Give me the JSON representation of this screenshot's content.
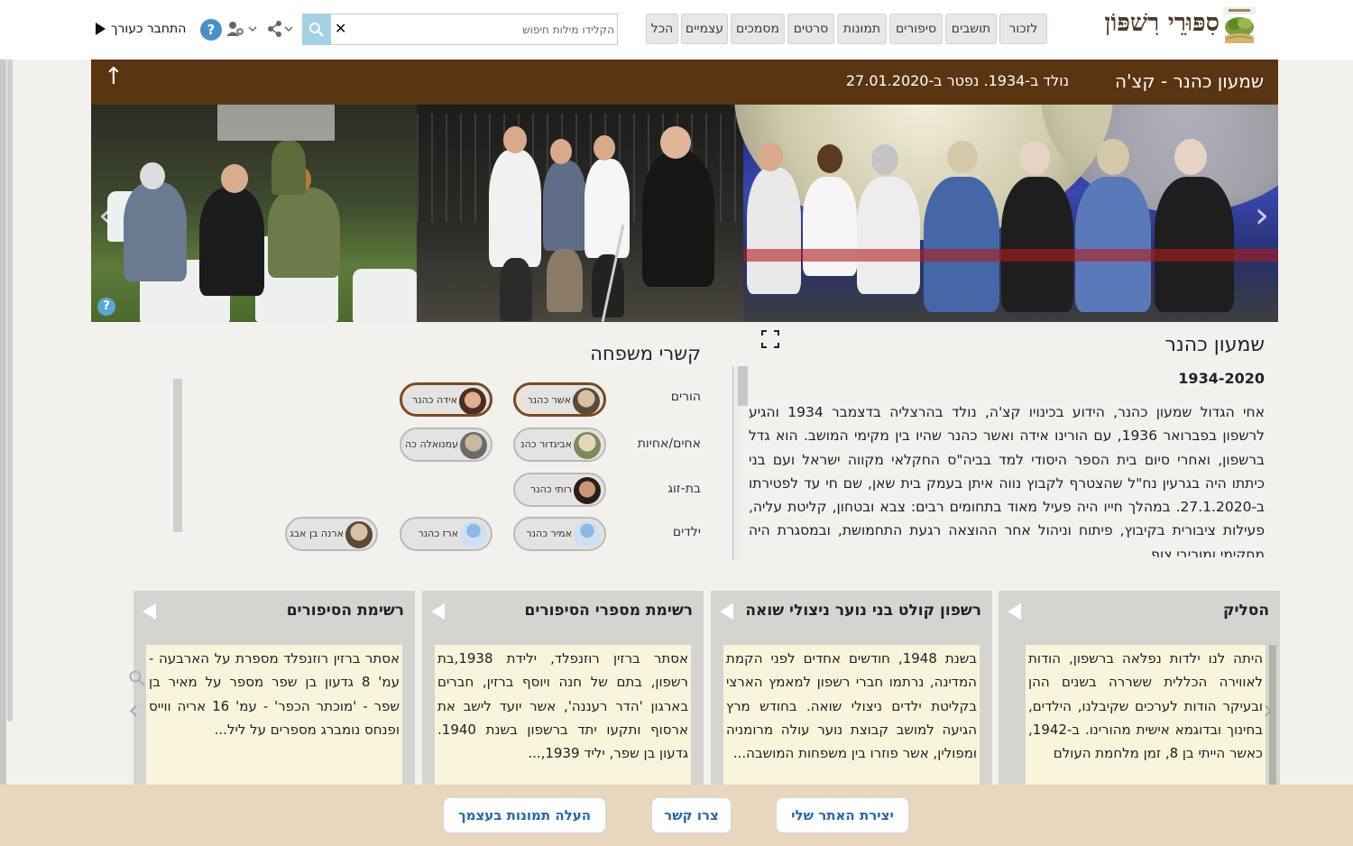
{
  "header": {
    "site_title": "סִפּוּרֵי רִשׁפּוֹן",
    "categories": [
      "לזכור",
      "תושבים",
      "סיפורים",
      "תמונות",
      "סרטים",
      "מסמכים",
      "עצמיים",
      "הכל"
    ],
    "search_placeholder": "הקלידו מילות חיפוש",
    "login_label": "התחבר כעורך"
  },
  "person_bar": {
    "name": "שמעון כהנר - קצ'ה",
    "dates": "נולד ב-1934. נפטר ב-27.01.2020"
  },
  "bio": {
    "name": "שמעון כהנר",
    "years": "1934-2020",
    "text": "אחי הגדול שמעון כהנר, הידוע בכינויו קצ'ה, נולד בהרצליה בדצמבר 1934 והגיע לרשפון בפברואר 1936, עם הורינו אידה ואשר כהנר שהיו בין מקימי המושב. הוא גדל ברשפון, ואחרי סיום בית הספר היסודי למד בביה\"ס החקלאי מקווה ישראל ועם בני כיתתו היה בגרעין נח\"ל שהצטרף לקבוץ נווה איתן בעמק בית שאן, שם חי עד לפטירתו ב-27.1.2020. במהלך חייו היה פעיל מאוד בתחומים רבים: צבא ובטחון, קליטת עליה, פעילות ציבורית בקיבוץ, פיתוח וניהול אחר ההוצאה רגעת התחמושת, ובמסגרת היה מחקימי ומוריבי צוף"
  },
  "family": {
    "title": "קשרי משפחה",
    "relations": {
      "parents": "הורים",
      "siblings": "אחים/אחיות",
      "spouse": "בת-זוג",
      "children": "ילדים"
    },
    "members": {
      "father": "אשר כהנר",
      "mother": "אידה כהנר",
      "sibling_1": "אביגדור כהנ",
      "sibling_2": "עמנואלה כה",
      "spouse": "רותי כהנר",
      "child_1": "אמיר כהנר",
      "child_2": "ארז כהנר",
      "child_3": "ארנה בן אבג"
    }
  },
  "cards": [
    {
      "title": "הסליק",
      "body": "היתה לנו ילדות נפלאה ברשפון, הודות לאווירה הכללית ששררה בשנים ההן ובעיקר הודות לערכים שקיבלנו, הילדים, בחינוך ובדוגמא אישית מהורינו. ב-1942, כאשר הייתי בן 8, זמן מלחמת העולם"
    },
    {
      "title": "רשפון קולט בני נוער ניצולי שואה",
      "body": "בשנת 1948, חודשים אחדים לפני הקמת המדינה, נרתמו חברי רשפון למאמץ הארצי בקליטת ילדים ניצולי שואה. בחודש מרץ הגיעה למושב קבוצת נוער עולה מרומניה ומפולין, אשר פוזרו בין משפחות המושבה..."
    },
    {
      "title": "רשימת מספרי הסיפורים",
      "body": "אסתר ברזין רוזנפלד, ילידת 1938,בת רשפון, בתם של חנה ויוסף ברזין, חברים בארגון 'הדר רעננה', אשר יועד לישב את ארסוף ותקעו יתד ברשפון בשנת 1940. גדעון בן שפר, יליד 1939,..."
    },
    {
      "title": "רשימת הסיפורים",
      "body": "אסתר ברזין רוזנפלד מספרת על הארבעה - עמ' 8 גדעון בן שפר מספר על מאיר בן שפר - 'מוכתר הכפר' - עמ' 16 אריה ווייס ופנחס נומברג מספרים על ליל..."
    }
  ],
  "footer": {
    "create_site": "יצירת האתר שלי",
    "contact": "צרו קשר",
    "upload_photos": "העלה תמונות בעצמך"
  }
}
